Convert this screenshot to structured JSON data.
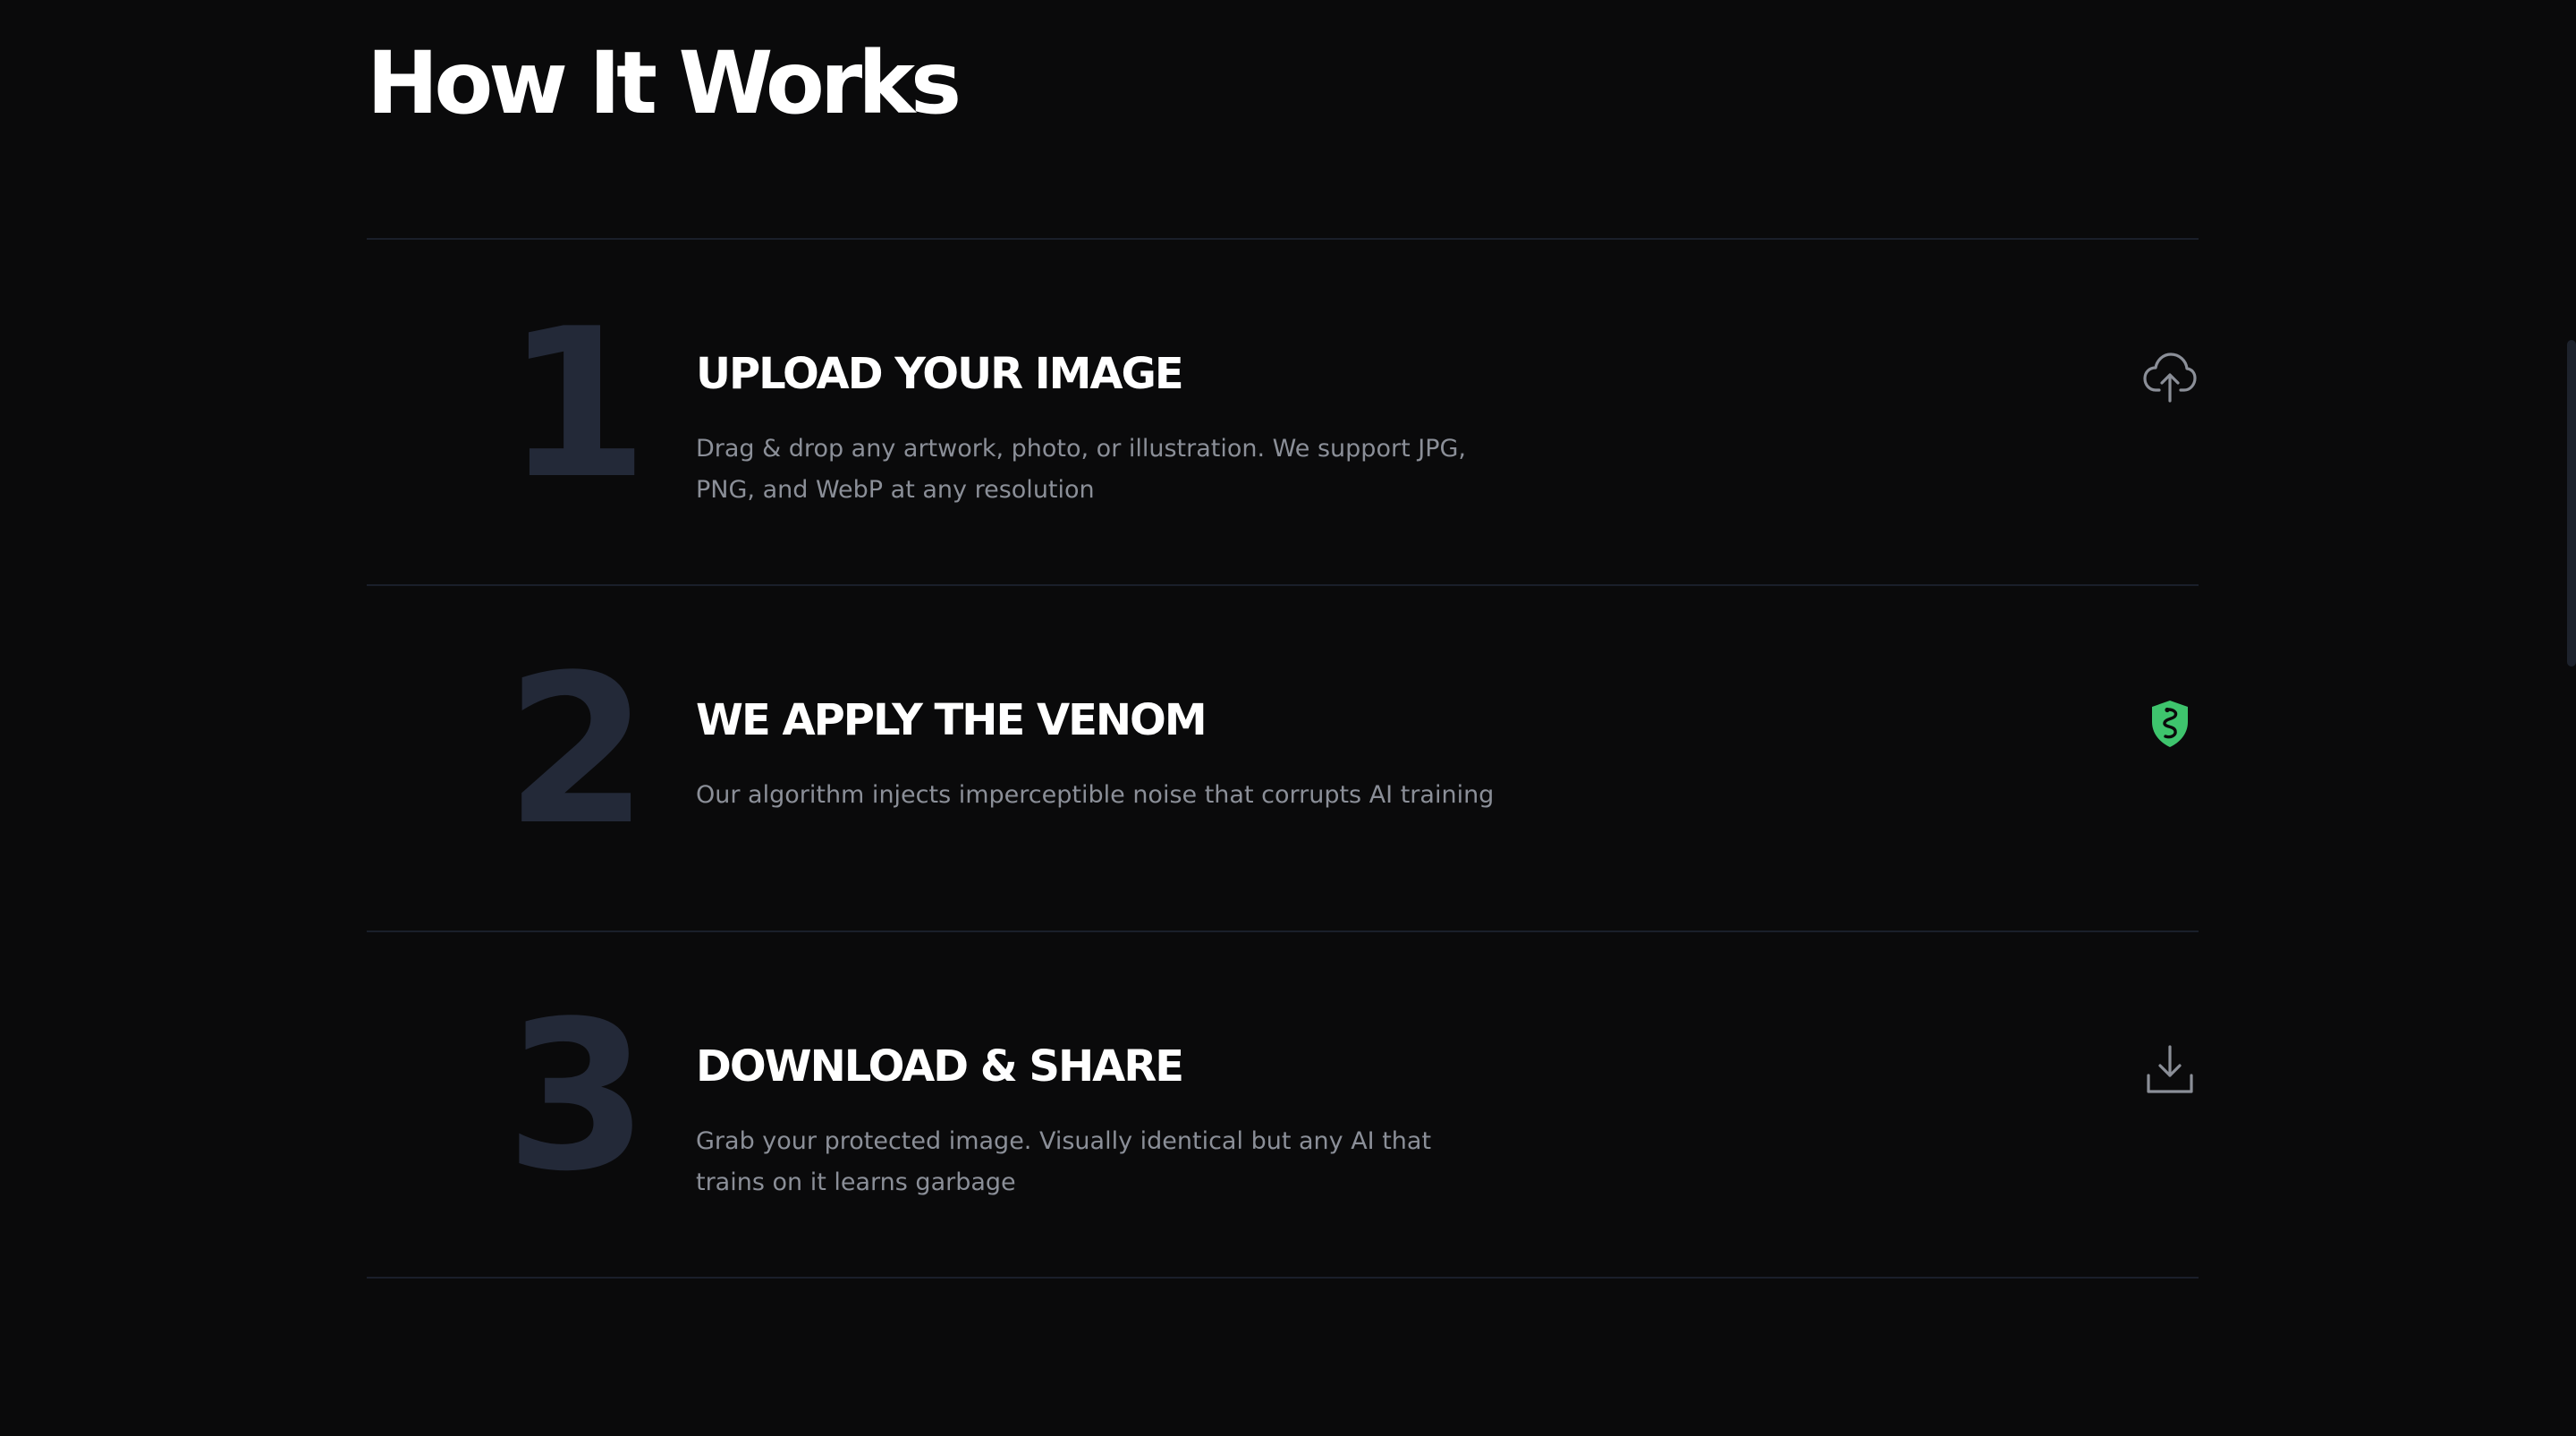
{
  "section": {
    "title": "How It Works"
  },
  "steps": [
    {
      "number": "1",
      "heading": "UPLOAD YOUR IMAGE",
      "description": "Drag & drop any artwork, photo, or illustration. We support JPG, PNG, and WebP at any resolution",
      "icon": "cloud-upload-icon"
    },
    {
      "number": "2",
      "heading": "WE APPLY THE VENOM",
      "description": "Our algorithm injects imperceptible noise that corrupts AI training",
      "icon": "snake-shield-icon"
    },
    {
      "number": "3",
      "heading": "DOWNLOAD & SHARE",
      "description": "Grab your protected image. Visually identical but any AI that trains on it learns garbage",
      "icon": "download-icon"
    }
  ],
  "colors": {
    "background": "#0a0a0b",
    "accent_green": "#3ec46d",
    "step_number": "#232938",
    "muted_text": "#8b8f98",
    "divider": "#1a1f2a"
  }
}
